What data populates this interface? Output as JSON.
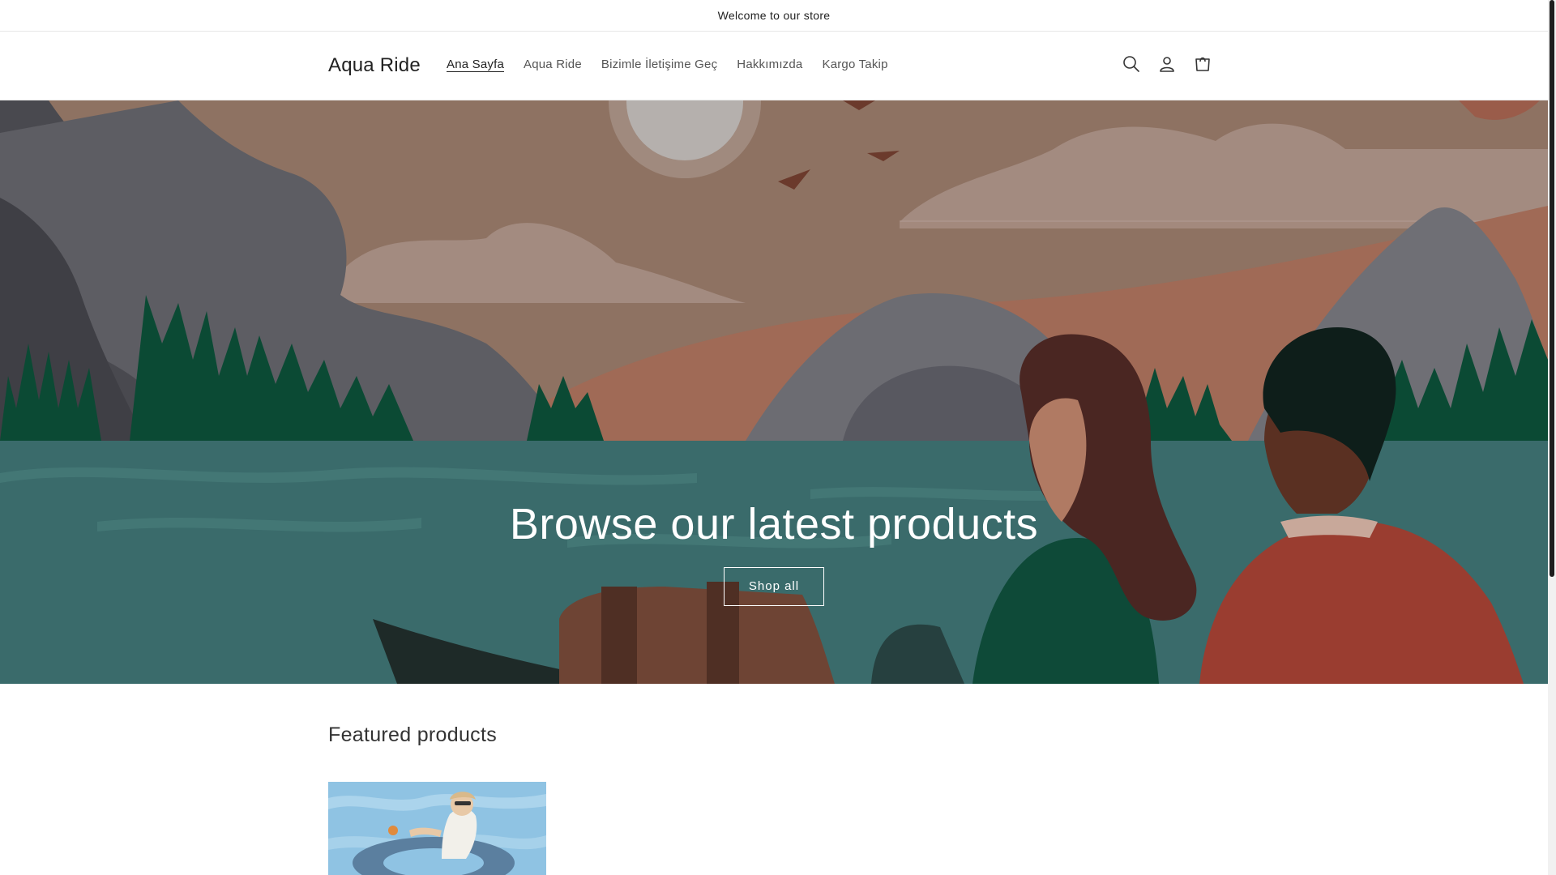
{
  "announcement": {
    "text": "Welcome to our store"
  },
  "header": {
    "logo": "Aqua Ride",
    "nav": [
      {
        "label": "Ana Sayfa",
        "active": true
      },
      {
        "label": "Aqua Ride",
        "active": false
      },
      {
        "label": "Bizimle İletişime Geç",
        "active": false
      },
      {
        "label": "Hakkımızda",
        "active": false
      },
      {
        "label": "Kargo Takip",
        "active": false
      }
    ],
    "icons": [
      "search-icon",
      "account-icon",
      "cart-icon"
    ]
  },
  "hero": {
    "title": "Browse our latest products",
    "button_label": "Shop all"
  },
  "featured": {
    "title": "Featured products"
  },
  "colors": {
    "sky": "#8e7262",
    "water": "#3a6b6b",
    "forest": "#0b4a34",
    "mountain": "#5c5c60"
  }
}
